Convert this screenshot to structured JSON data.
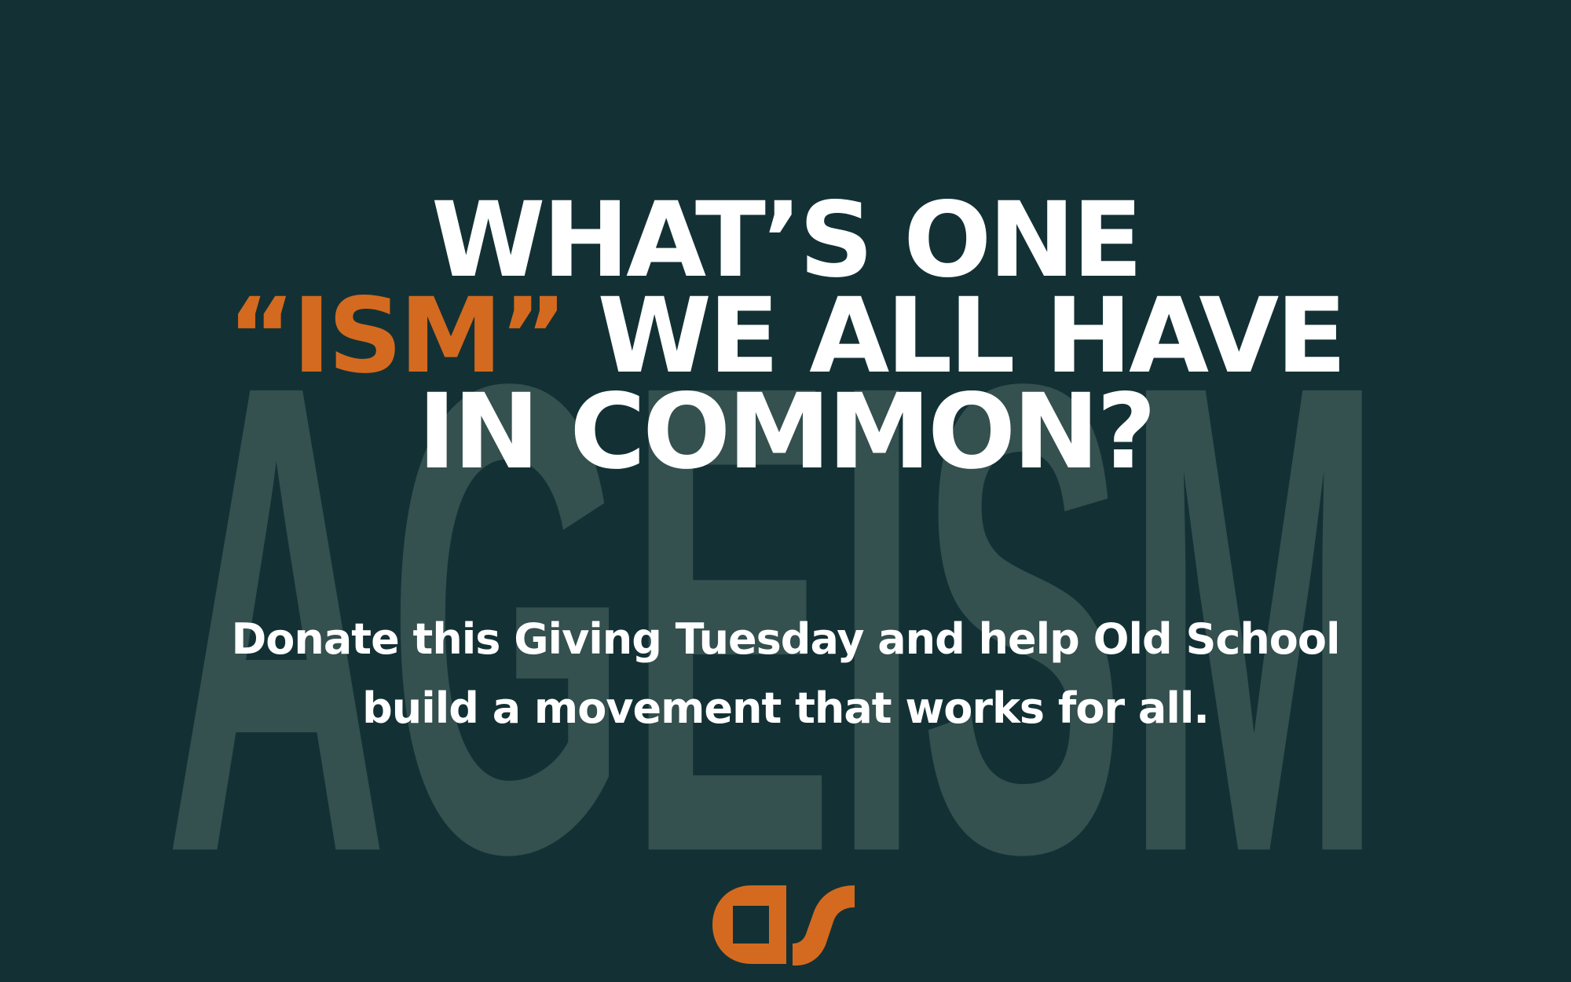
{
  "background_color": "#133135",
  "watermark": {
    "text": "AGEISM",
    "color": "#34504f"
  },
  "headline": {
    "line1": "WHAT’S ONE",
    "line2_accent": "“ISM”",
    "line2_rest": " WE ALL HAVE",
    "line3": "IN COMMON?",
    "accent_color": "#d46a1f"
  },
  "subtext": {
    "line1": "Donate this Giving Tuesday and help Old School",
    "line2": "build a movement that works for all."
  },
  "logo": {
    "icon": "old-school-logo",
    "color": "#d46a1f"
  }
}
